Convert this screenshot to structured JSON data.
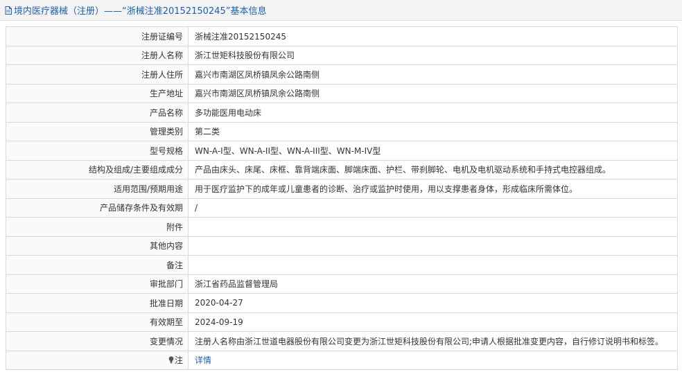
{
  "header": {
    "title": "境内医疗器械（注册）——“浙械注准20152150245”基本信息",
    "icon": "document-icon"
  },
  "rows": [
    {
      "label": "注册证编号",
      "value": "浙械注准20152150245"
    },
    {
      "label": "注册人名称",
      "value": "浙江世矩科技股份有限公司"
    },
    {
      "label": "注册人住所",
      "value": "嘉兴市南湖区凤桥镇凤余公路南侧"
    },
    {
      "label": "生产地址",
      "value": "嘉兴市南湖区凤桥镇凤余公路南侧"
    },
    {
      "label": "产品名称",
      "value": "多功能医用电动床"
    },
    {
      "label": "管理类别",
      "value": "第二类"
    },
    {
      "label": "型号规格",
      "value": "WN-A-I型、WN-A-II型、WN-A-III型、WN-M-IV型"
    },
    {
      "label": "结构及组成/主要组成成分",
      "value": "产品由床头、床尾、床框、靠背端床面、脚端床面、护栏、带刹脚轮、电机及电机驱动系统和手持式电控器组成。"
    },
    {
      "label": "适用范围/预期用途",
      "value": "用于医疗监护下的成年或儿童患者的诊断、治疗或监护时使用，用以支撑患者身体，形成临床所需体位。"
    },
    {
      "label": "产品储存条件及有效期",
      "value": "/"
    },
    {
      "label": "附件",
      "value": ""
    },
    {
      "label": "其他内容",
      "value": ""
    },
    {
      "label": "备注",
      "value": ""
    },
    {
      "label": "审批部门",
      "value": "浙江省药品监督管理局"
    },
    {
      "label": "批准日期",
      "value": "2020-04-27"
    },
    {
      "label": "有效期至",
      "value": "2024-09-19"
    },
    {
      "label": "变更情况",
      "value": "注册人名称由浙江世道电器股份有限公司变更为浙江世矩科技股份有限公司;申请人根据批准变更内容，自行修订说明书和标签。"
    }
  ],
  "note_row": {
    "label": "注",
    "link": "详情",
    "icon": "lightbulb-icon"
  },
  "colors": {
    "accent": "#1f5fa8",
    "border": "#d9d9d9",
    "header_bg": "#f3f3f3"
  }
}
